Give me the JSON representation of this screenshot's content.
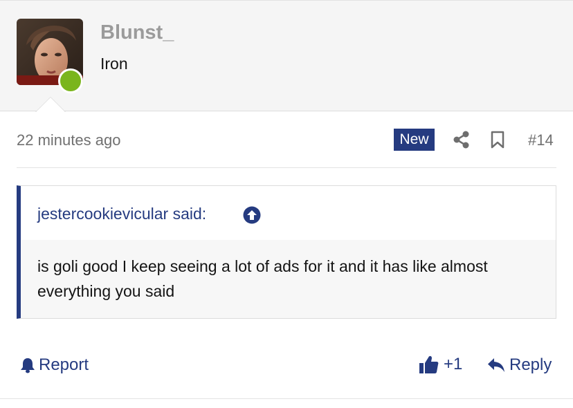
{
  "user": {
    "name": "Blunst_",
    "title": "Iron",
    "status_color": "#7ab51d"
  },
  "post": {
    "time": "22 minutes ago",
    "badge": "New",
    "number": "#14"
  },
  "quote": {
    "author_label": "jestercookievicular said:",
    "text": "is goli good I keep seeing a lot of ads for it and it has like almost everything you said"
  },
  "actions": {
    "report_label": "Report",
    "like_count": "+1",
    "reply_label": "Reply"
  },
  "icons": {
    "share": "share-icon",
    "bookmark": "bookmark-icon",
    "quote_up": "arrow-up-circle-icon",
    "report": "bell-icon",
    "like": "thumbs-up-icon",
    "reply": "reply-arrow-icon"
  },
  "colors": {
    "accent": "#253b80",
    "header_bg": "#f5f5f5",
    "muted_text": "#707070"
  }
}
